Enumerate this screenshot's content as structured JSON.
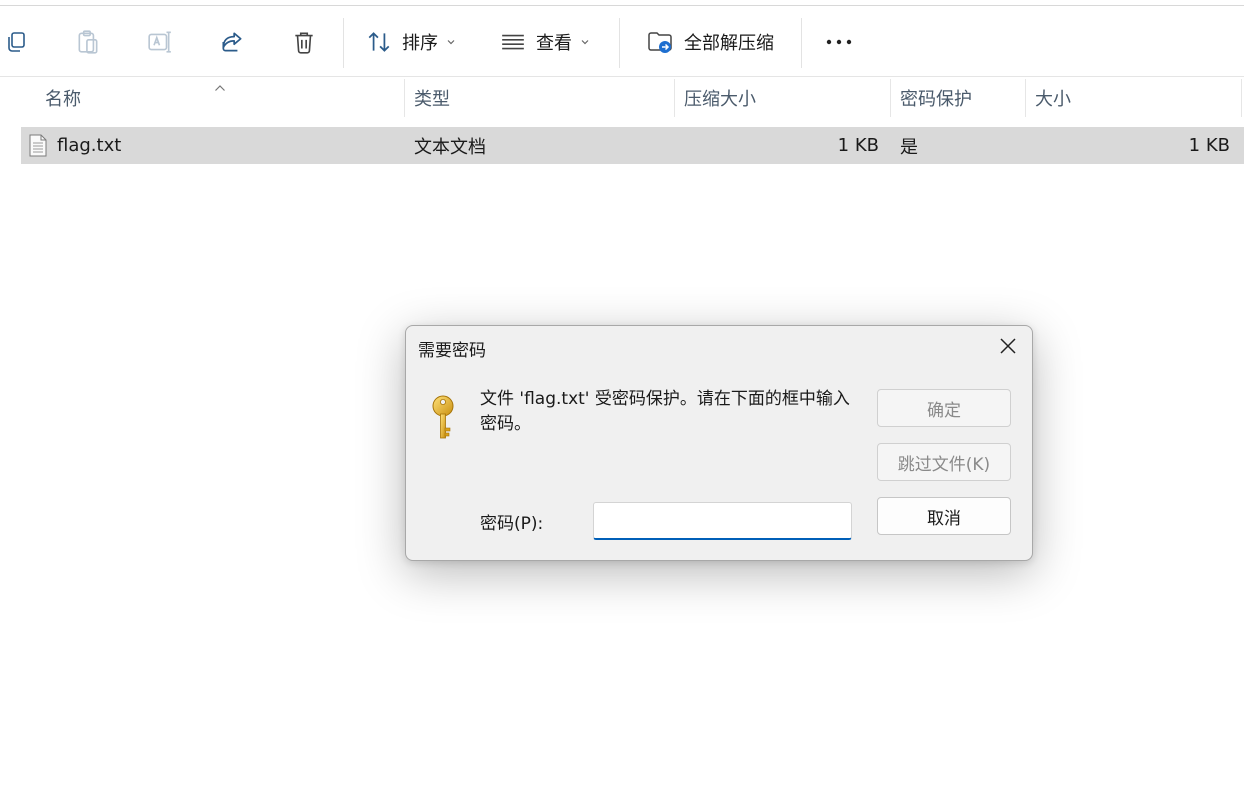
{
  "toolbar": {
    "sort_label": "排序",
    "view_label": "查看",
    "extract_all_label": "全部解压缩",
    "more_label": "•••"
  },
  "columns": {
    "name": "名称",
    "type": "类型",
    "compressed_size": "压缩大小",
    "password_protected": "密码保护",
    "size": "大小"
  },
  "rows": [
    {
      "name": "flag.txt",
      "type": "文本文档",
      "compressed_size": "1 KB",
      "password_protected": "是",
      "size": "1 KB"
    }
  ],
  "dialog": {
    "title": "需要密码",
    "message": "文件 'flag.txt' 受密码保护。请在下面的框中输入密码。",
    "ok_label": "确定",
    "skip_label": "跳过文件(K)",
    "cancel_label": "取消",
    "password_label": "密码(P):",
    "password_value": ""
  },
  "colors": {
    "accent": "#005fb8",
    "selected_row": "#d9d9d9",
    "dialog_bg": "#f0f0f0",
    "key_gold": "#e8b923"
  },
  "icons": [
    "copy-icon",
    "paste-icon",
    "rename-icon",
    "share-icon",
    "delete-icon",
    "sort-icon",
    "view-icon",
    "extract-icon",
    "more-icon",
    "text-file-icon",
    "key-icon",
    "close-icon"
  ]
}
